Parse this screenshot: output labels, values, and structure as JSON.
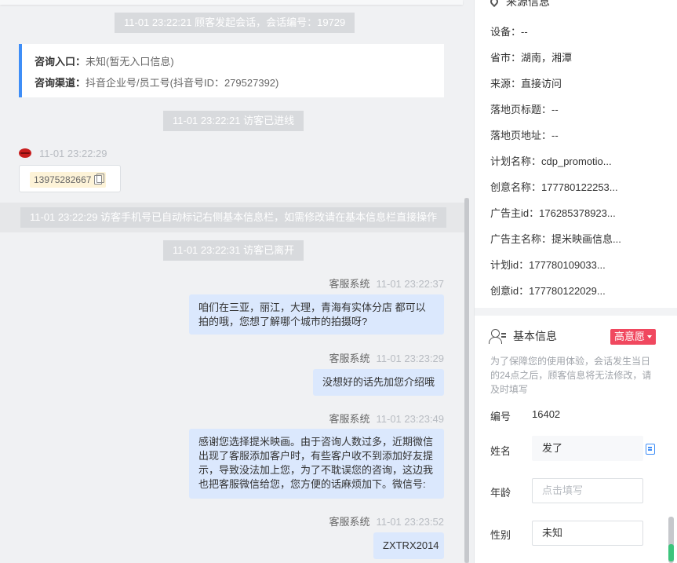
{
  "chat": {
    "session_start": "11-01 23:22:21 顾客发起会话，会话编号：19729",
    "consult_entry_label": "咨询入口：",
    "consult_entry_value": "未知(暂无入口信息)",
    "consult_channel_label": "咨询渠道：",
    "consult_channel_value": "抖音企业号/员工号(抖音号ID：279527392)",
    "visitor_entered": "11-01 23:22:21 访客已进线",
    "visitor_time": "11-01 23:22:29",
    "visitor_phone": "13975282667",
    "phone_notice": "11-01 23:22:29 访客手机号已自动标记右侧基本信息栏，如需修改请在基本信息栏直接操作",
    "visitor_left": "11-01 23:22:31 访客已离开",
    "messages": [
      {
        "sender": "客服系统",
        "time": "11-01 23:22:37",
        "text": "咱们在三亚，丽江，大理，青海有实体分店 都可以拍的哦，您想了解哪个城市的拍摄呀?"
      },
      {
        "sender": "客服系统",
        "time": "11-01 23:23:29",
        "text": "没想好的话先加您介绍哦"
      },
      {
        "sender": "客服系统",
        "time": "11-01 23:23:49",
        "text": "感谢您选择提米映画。由于咨询人数过多，近期微信出现了客服添加客户时，有些客户收不到添加好友提示，导致没法加上您，为了不耽误您的咨询，这边我也把客服微信给您，您方便的话麻烦加下。微信号:"
      },
      {
        "sender": "客服系统",
        "time": "11-01 23:23:52",
        "text": "ZXTRX2014"
      }
    ]
  },
  "source_info": {
    "title": "来源信息",
    "rows": [
      {
        "label": "设备：",
        "value": "--"
      },
      {
        "label": "省市：",
        "value": "湖南，湘潭"
      },
      {
        "label": "来源：",
        "value": "直接访问"
      },
      {
        "label": "落地页标题：",
        "value": "--"
      },
      {
        "label": "落地页地址：",
        "value": "--"
      },
      {
        "label": "计划名称：",
        "value": "cdp_promotio..."
      },
      {
        "label": "创意名称：",
        "value": "177780122253..."
      },
      {
        "label": "广告主id：",
        "value": "176285378923..."
      },
      {
        "label": "广告主名称：",
        "value": "提米映画信息..."
      },
      {
        "label": "计划id：",
        "value": "177780109033..."
      },
      {
        "label": "创意id：",
        "value": "177780122029..."
      }
    ]
  },
  "basic_info": {
    "title": "基本信息",
    "intent_badge": "高意愿",
    "hint": "为了保障您的使用体验，会话发生当日的24点之后，顾客信息将无法修改，请及时填写",
    "id_label": "编号",
    "id_value": "16402",
    "name_label": "姓名",
    "name_value": "发了",
    "age_label": "年龄",
    "age_placeholder": "点击填写",
    "gender_label": "性别",
    "gender_value": "未知"
  },
  "colors": {
    "accent_blue": "#3f8ef7",
    "bubble_blue": "#dbe8fd",
    "badge_red": "#f0485f",
    "scroll_green": "#3cc47c"
  }
}
